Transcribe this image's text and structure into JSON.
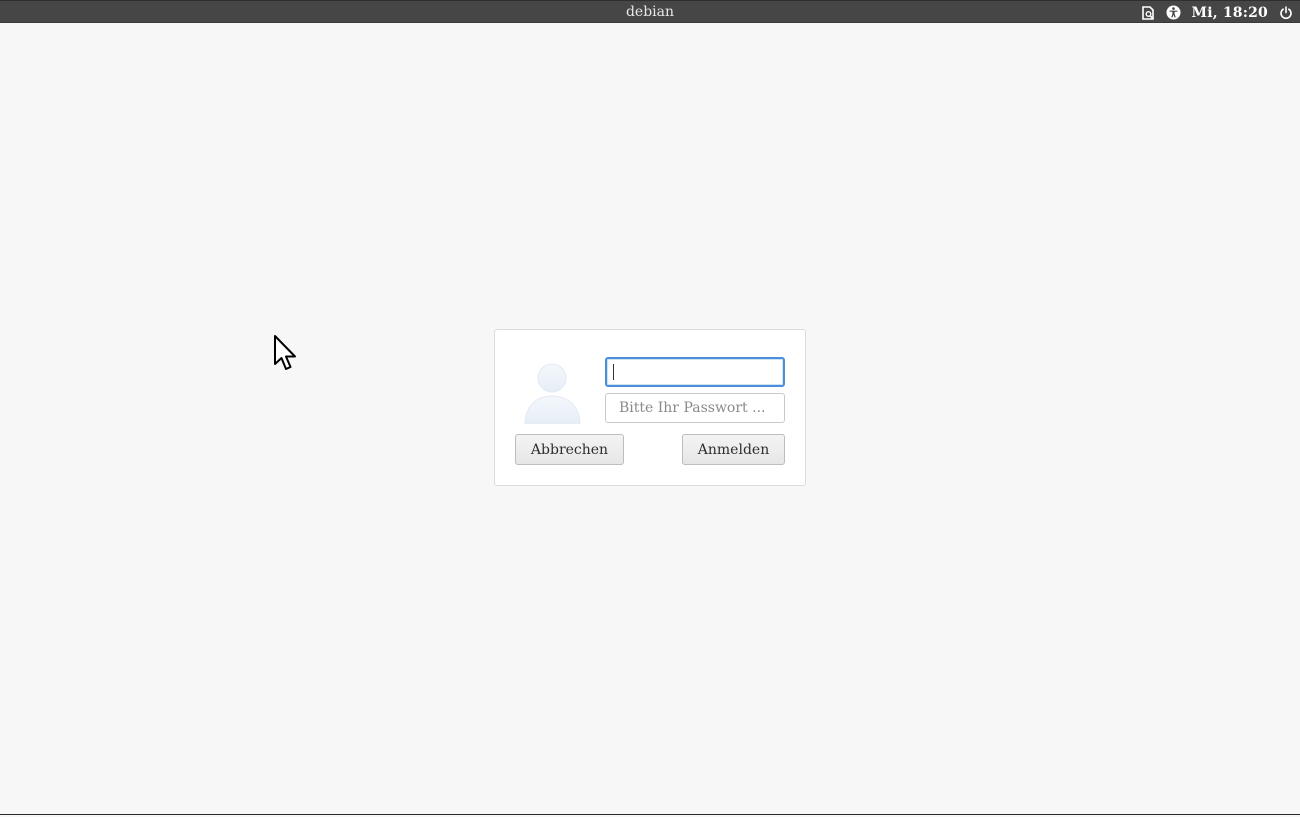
{
  "panel": {
    "hostname": "debian",
    "clock": "Mi, 18:20",
    "icons": [
      "keyboard-layout-icon",
      "accessibility-icon",
      "power-icon"
    ]
  },
  "login": {
    "username_value": "",
    "password_placeholder": "Bitte Ihr Passwort ...",
    "cancel_label": "Abbrechen",
    "login_label": "Anmelden"
  },
  "colors": {
    "panel_bg": "#464646",
    "desktop_bg": "#f7f7f7",
    "focus_border": "#4a90d9"
  }
}
